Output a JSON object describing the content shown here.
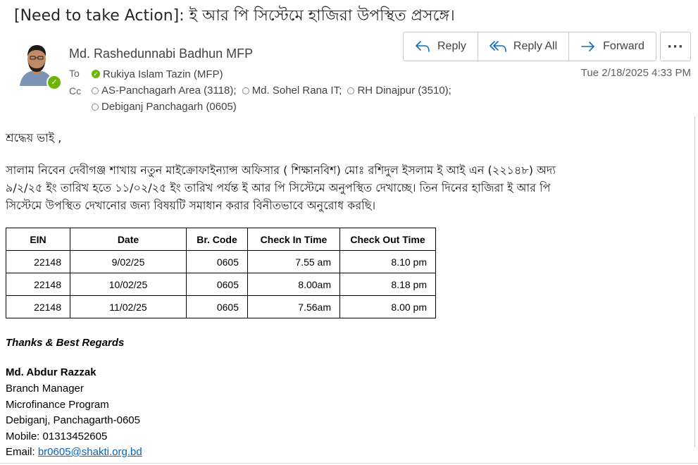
{
  "email": {
    "subject": "[Need to take Action]: ই আর পি সিস্টেমে হাজিরা উপস্থিত প্রসঙ্গে।",
    "sender": "Md. Rashedunnabi Badhun MFP",
    "to_label": "To",
    "cc_label": "Cc",
    "to": [
      {
        "name": "Rukiya Islam Tazin (MFP)",
        "status": "available"
      }
    ],
    "cc": [
      {
        "name": "AS-Panchagarh Area (3118);"
      },
      {
        "name": "Md. Sohel Rana IT;"
      },
      {
        "name": "RH Dinajpur (3510);"
      },
      {
        "name": "Debiganj Panchagarh (0605)"
      }
    ],
    "date": "Tue 2/18/2025 4:33 PM",
    "actions": {
      "reply": "Reply",
      "reply_all": "Reply All",
      "forward": "Forward",
      "more": "···"
    }
  },
  "body": {
    "greeting": "শ্রদ্ধেয় ভাই ,",
    "lines": [
      "সালাম নিবেন দেবীগঞ্জ শাখায় নতুন মাইক্রোফাইন্যান্স অফিসার ( শিক্ষানবিশ) মোঃ রশিদুল ইসলাম ই আই এন (২২১৪৮) অদ্য",
      "৯/২/২৫  ইং  তারিখ হতে ১১/০২/২৫ ইং তারিখ পর্যন্ত ই আর পি সিস্টেমে অনুপস্থিত দেখাচ্ছে। তিন দিনের হাজিরা ই আর পি",
      "সিস্টেমে  উপস্থিত দেখানোর জন্য বিষয়টি সমাধান করার বিনীতভাবে অনুরোধ করছি।"
    ]
  },
  "table": {
    "headers": [
      "EIN",
      "Date",
      "Br. Code",
      "Check In Time",
      "Check Out Time"
    ],
    "rows": [
      [
        "22148",
        "9/02/25",
        "0605",
        "7.55 am",
        "8.10 pm"
      ],
      [
        "22148",
        "10/02/25",
        "0605",
        "8.00am",
        "8.18 pm"
      ],
      [
        "22148",
        "11/02/25",
        "0605",
        "7.56am",
        "8.00 pm"
      ]
    ]
  },
  "signature": {
    "thanks": "Thanks & Best Regards",
    "name": "Md. Abdur Razzak",
    "title": "Branch Manager",
    "program": "Microfinance Program",
    "address": "Debiganj, Panchagarth-0605",
    "mobile": "Mobile: 01313452605",
    "email_label": "Email: ",
    "email": "br0605@shakti.org.bd"
  },
  "colors": {
    "presence_available": "#6bb700",
    "link": "#0563c1",
    "accent": "#0f6cbd"
  },
  "icons": {
    "reply": "reply-icon",
    "reply_all": "reply-all-icon",
    "forward": "forward-icon",
    "more": "more-icon",
    "presence": "presence-available-icon"
  }
}
